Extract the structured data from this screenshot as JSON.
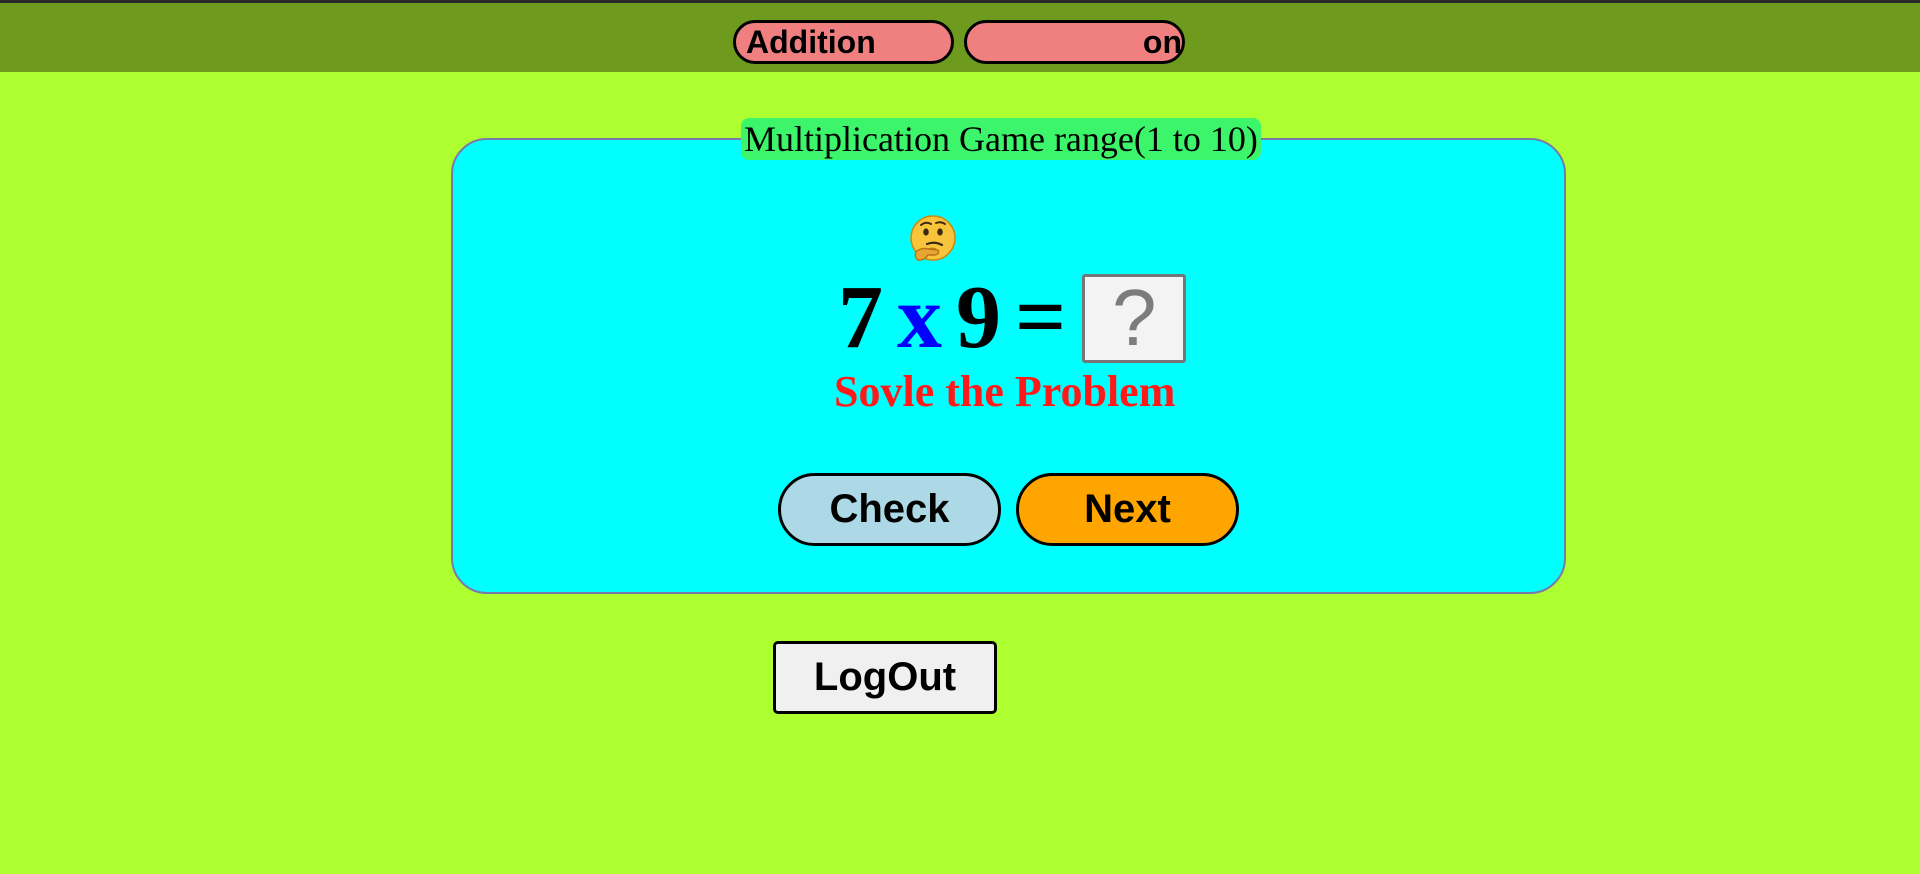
{
  "nav": {
    "addition_label": "Addition",
    "second_label_visible": "on"
  },
  "game": {
    "title": "Multiplication Game range(1 to 10)",
    "emoji": "thinking-face",
    "operand_a": "7",
    "operator": "x",
    "operand_b": "9",
    "equals": "=",
    "answer_placeholder": "?",
    "answer_value": "",
    "status_message": "Sovle the Problem",
    "check_label": "Check",
    "next_label": "Next"
  },
  "logout_label": "LogOut",
  "colors": {
    "topbar": "#6e9a1e",
    "page_background": "#adff2f",
    "card_background": "#00ffff",
    "title_background": "#3df56b",
    "nav_button": "#f08080",
    "operator": "#0000ff",
    "status_message": "#ff1a1a",
    "check_button": "#add8e6",
    "next_button": "#ffa500",
    "logout_button": "#f0f0f0"
  }
}
